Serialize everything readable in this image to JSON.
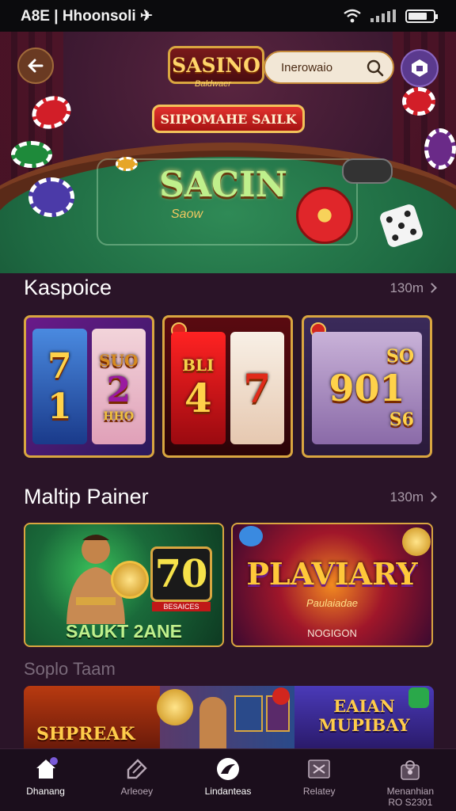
{
  "status_bar": {
    "left_text": "A8E | Hhoonsoli ✈"
  },
  "header": {
    "logo_text": "SASINO",
    "logo_subtitle": "Baldwaer",
    "search_placeholder": "Inerowaio",
    "promo_label": "SIIPOMAHE SAILK"
  },
  "hero": {
    "table_title": "SACIN",
    "table_subtitle": "Saow"
  },
  "section1": {
    "title": "Kaspoice",
    "see_more": "130m",
    "cards": [
      {
        "reels": [
          "7",
          "2"
        ],
        "extra": [
          "1",
          "SUO",
          "HHO"
        ]
      },
      {
        "reels": [
          "4",
          "7"
        ],
        "extra": [
          "BLI"
        ]
      },
      {
        "reels": [
          "901"
        ],
        "extra": [
          "SO",
          "S6"
        ]
      }
    ]
  },
  "section2": {
    "title": "Maltip Painer",
    "see_more": "130m",
    "cards": [
      {
        "title": "SAUKT 2ANE",
        "number": "70",
        "small": "BESAICES"
      },
      {
        "title": "PLAVIARY",
        "subtitle": "Paulaiadae",
        "caption": "NOGIGON"
      }
    ]
  },
  "section3": {
    "title": "Soplo Taam",
    "strip": [
      "SHPREAK",
      "EAIAN MUPIBAY"
    ]
  },
  "bottom_nav": [
    {
      "label": "Dhanang",
      "icon": "home-icon"
    },
    {
      "label": "Arleoey",
      "icon": "tag-icon"
    },
    {
      "label": "Lindanteas",
      "icon": "bird-icon"
    },
    {
      "label": "Relatey",
      "icon": "ticket-icon"
    },
    {
      "label": "Menanhian",
      "sublabel": "RO S2301",
      "icon": "person-icon"
    }
  ],
  "colors": {
    "background": "#2a1428",
    "accent_gold": "#d9a640",
    "felt_green": "#1e6a42",
    "promo_red": "#c11a18"
  }
}
